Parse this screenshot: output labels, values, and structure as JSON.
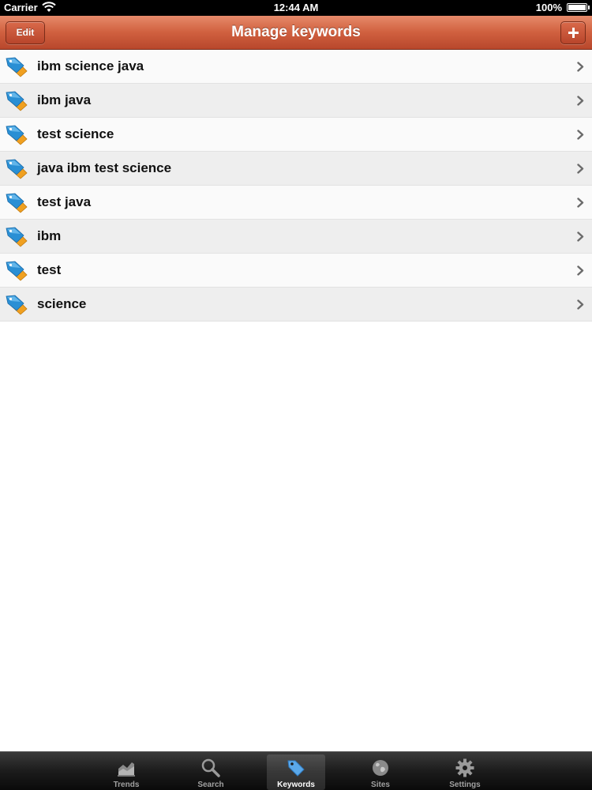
{
  "status_bar": {
    "carrier": "Carrier",
    "time": "12:44 AM",
    "battery": "100%"
  },
  "nav": {
    "title": "Manage keywords",
    "edit_label": "Edit",
    "add_icon": "plus-icon"
  },
  "keywords": [
    {
      "label": "ibm science java"
    },
    {
      "label": "ibm java"
    },
    {
      "label": "test science"
    },
    {
      "label": "java ibm test science"
    },
    {
      "label": "test java"
    },
    {
      "label": "ibm"
    },
    {
      "label": "test"
    },
    {
      "label": "science"
    }
  ],
  "tabs": [
    {
      "label": "Trends",
      "icon": "trends-chart-icon",
      "active": false
    },
    {
      "label": "Search",
      "icon": "search-icon",
      "active": false
    },
    {
      "label": "Keywords",
      "icon": "tag-icon",
      "active": true
    },
    {
      "label": "Sites",
      "icon": "globe-icon",
      "active": false
    },
    {
      "label": "Settings",
      "icon": "gear-icon",
      "active": false
    }
  ],
  "colors": {
    "nav_accent": "#d0603f",
    "tag_blue": "#2a8fd4",
    "tag_orange": "#f0a020"
  }
}
